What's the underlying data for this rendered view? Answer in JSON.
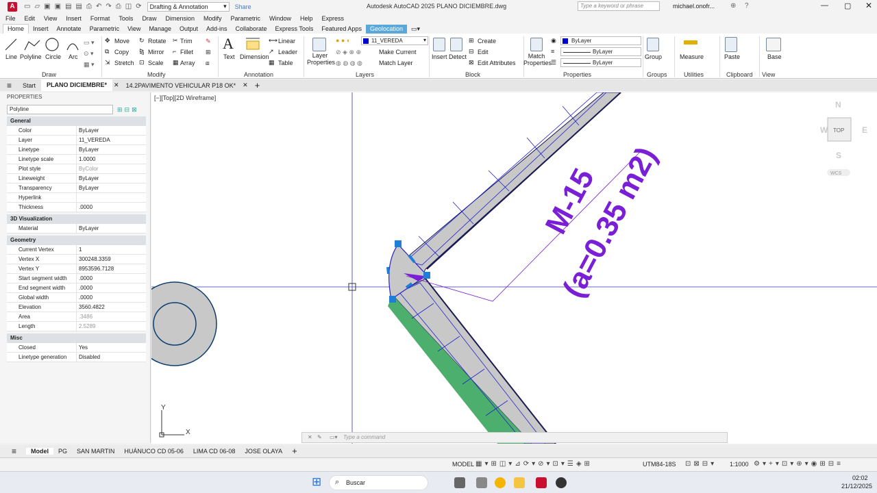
{
  "app": {
    "logo": "A",
    "workspace": "Drafting & Annotation",
    "share": "Share",
    "title": "Autodesk AutoCAD 2025   PLANO DICIEMBRE.dwg",
    "search_placeholder": "Type a keyword or phrase",
    "user": "michael.onofr..."
  },
  "menu": [
    "File",
    "Edit",
    "View",
    "Insert",
    "Format",
    "Tools",
    "Draw",
    "Dimension",
    "Modify",
    "Parametric",
    "Window",
    "Help",
    "Express"
  ],
  "ribbon_tabs": [
    "Home",
    "Insert",
    "Annotate",
    "Parametric",
    "View",
    "Manage",
    "Output",
    "Add-ins",
    "Collaborate",
    "Express Tools",
    "Featured Apps",
    "Geolocation"
  ],
  "ribbon": {
    "draw": {
      "line": "Line",
      "polyline": "Polyline",
      "circle": "Circle",
      "arc": "Arc",
      "panel": "Draw"
    },
    "modify": {
      "move": "Move",
      "rotate": "Rotate",
      "trim": "Trim",
      "copy": "Copy",
      "mirror": "Mirror",
      "fillet": "Fillet",
      "stretch": "Stretch",
      "scale": "Scale",
      "array": "Array",
      "panel": "Modify"
    },
    "annotation": {
      "text": "Text",
      "dimension": "Dimension",
      "linear": "Linear",
      "leader": "Leader",
      "table": "Table",
      "panel": "Annotation"
    },
    "layers": {
      "layer_properties": "Layer Properties",
      "current_layer": "11_VEREDA",
      "make_current": "Make Current",
      "match_layer": "Match Layer",
      "panel": "Layers"
    },
    "block": {
      "insert": "Insert",
      "detect": "Detect",
      "create": "Create",
      "edit": "Edit",
      "edit_attributes": "Edit Attributes",
      "panel": "Block"
    },
    "properties": {
      "match": "Match Properties",
      "color": "ByLayer",
      "linetype": "ByLayer",
      "lineweight": "ByLayer",
      "panel": "Properties"
    },
    "groups": {
      "group": "Group",
      "panel": "Groups"
    },
    "utilities": {
      "measure": "Measure",
      "panel": "Utilities"
    },
    "clipboard": {
      "paste": "Paste",
      "panel": "Clipboard"
    },
    "view": {
      "base": "Base",
      "panel": "View"
    }
  },
  "doc_tabs": [
    "Start",
    "PLANO DICIEMBRE*",
    "14.2PAVIMENTO VEHICULAR P18 OK*"
  ],
  "properties_panel": {
    "title": "PROPERTIES",
    "object_type": "Polyline",
    "general_title": "General",
    "general": [
      {
        "k": "Color",
        "v": "ByLayer"
      },
      {
        "k": "Layer",
        "v": "11_VEREDA"
      },
      {
        "k": "Linetype",
        "v": "ByLayer"
      },
      {
        "k": "Linetype scale",
        "v": "1.0000"
      },
      {
        "k": "Plot style",
        "v": "ByColor"
      },
      {
        "k": "Lineweight",
        "v": "ByLayer"
      },
      {
        "k": "Transparency",
        "v": "ByLayer"
      },
      {
        "k": "Hyperlink",
        "v": ""
      },
      {
        "k": "Thickness",
        "v": ".0000"
      }
    ],
    "viz_title": "3D Visualization",
    "viz": [
      {
        "k": "Material",
        "v": "ByLayer"
      }
    ],
    "geometry_title": "Geometry",
    "geometry": [
      {
        "k": "Current Vertex",
        "v": "1"
      },
      {
        "k": "Vertex X",
        "v": "300248.3359"
      },
      {
        "k": "Vertex Y",
        "v": "8953596.7128"
      },
      {
        "k": "Start segment width",
        "v": ".0000"
      },
      {
        "k": "End segment width",
        "v": ".0000"
      },
      {
        "k": "Global width",
        "v": ".0000"
      },
      {
        "k": "Elevation",
        "v": "3560.4822"
      },
      {
        "k": "Area",
        "v": ".3486"
      },
      {
        "k": "Length",
        "v": "2.5289"
      }
    ],
    "misc_title": "Misc",
    "misc": [
      {
        "k": "Closed",
        "v": "Yes"
      },
      {
        "k": "Linetype generation",
        "v": "Disabled"
      }
    ]
  },
  "viewport": {
    "label": "[−][Top][2D Wireframe]",
    "annotation_line1": "M-15",
    "annotation_line2": "(a=0.35 m2)",
    "viewcube": {
      "n": "N",
      "s": "S",
      "e": "E",
      "w": "W",
      "top": "TOP",
      "wcs": "WCS"
    },
    "ucs_x": "X",
    "ucs_y": "Y"
  },
  "command_placeholder": "Type a command",
  "layout_tabs": [
    "Model",
    "PG",
    "SAN MARTIN",
    "HUÁNUCO CD 05-06",
    "LIMA CD 06-08",
    "JOSE OLAYA"
  ],
  "status": {
    "model": "MODEL",
    "coord_system": "UTM84-18S",
    "scale": "1:1000"
  },
  "taskbar": {
    "search": "Buscar",
    "time": "02:02",
    "date": "21/12/2025"
  },
  "colors": {
    "accent_geo": "#5aa8d8",
    "annotation": "#7a1fd6",
    "layer_blue": "#0000cc",
    "road_green": "#4caf6e",
    "hatch_gray": "#c8c8c8"
  }
}
